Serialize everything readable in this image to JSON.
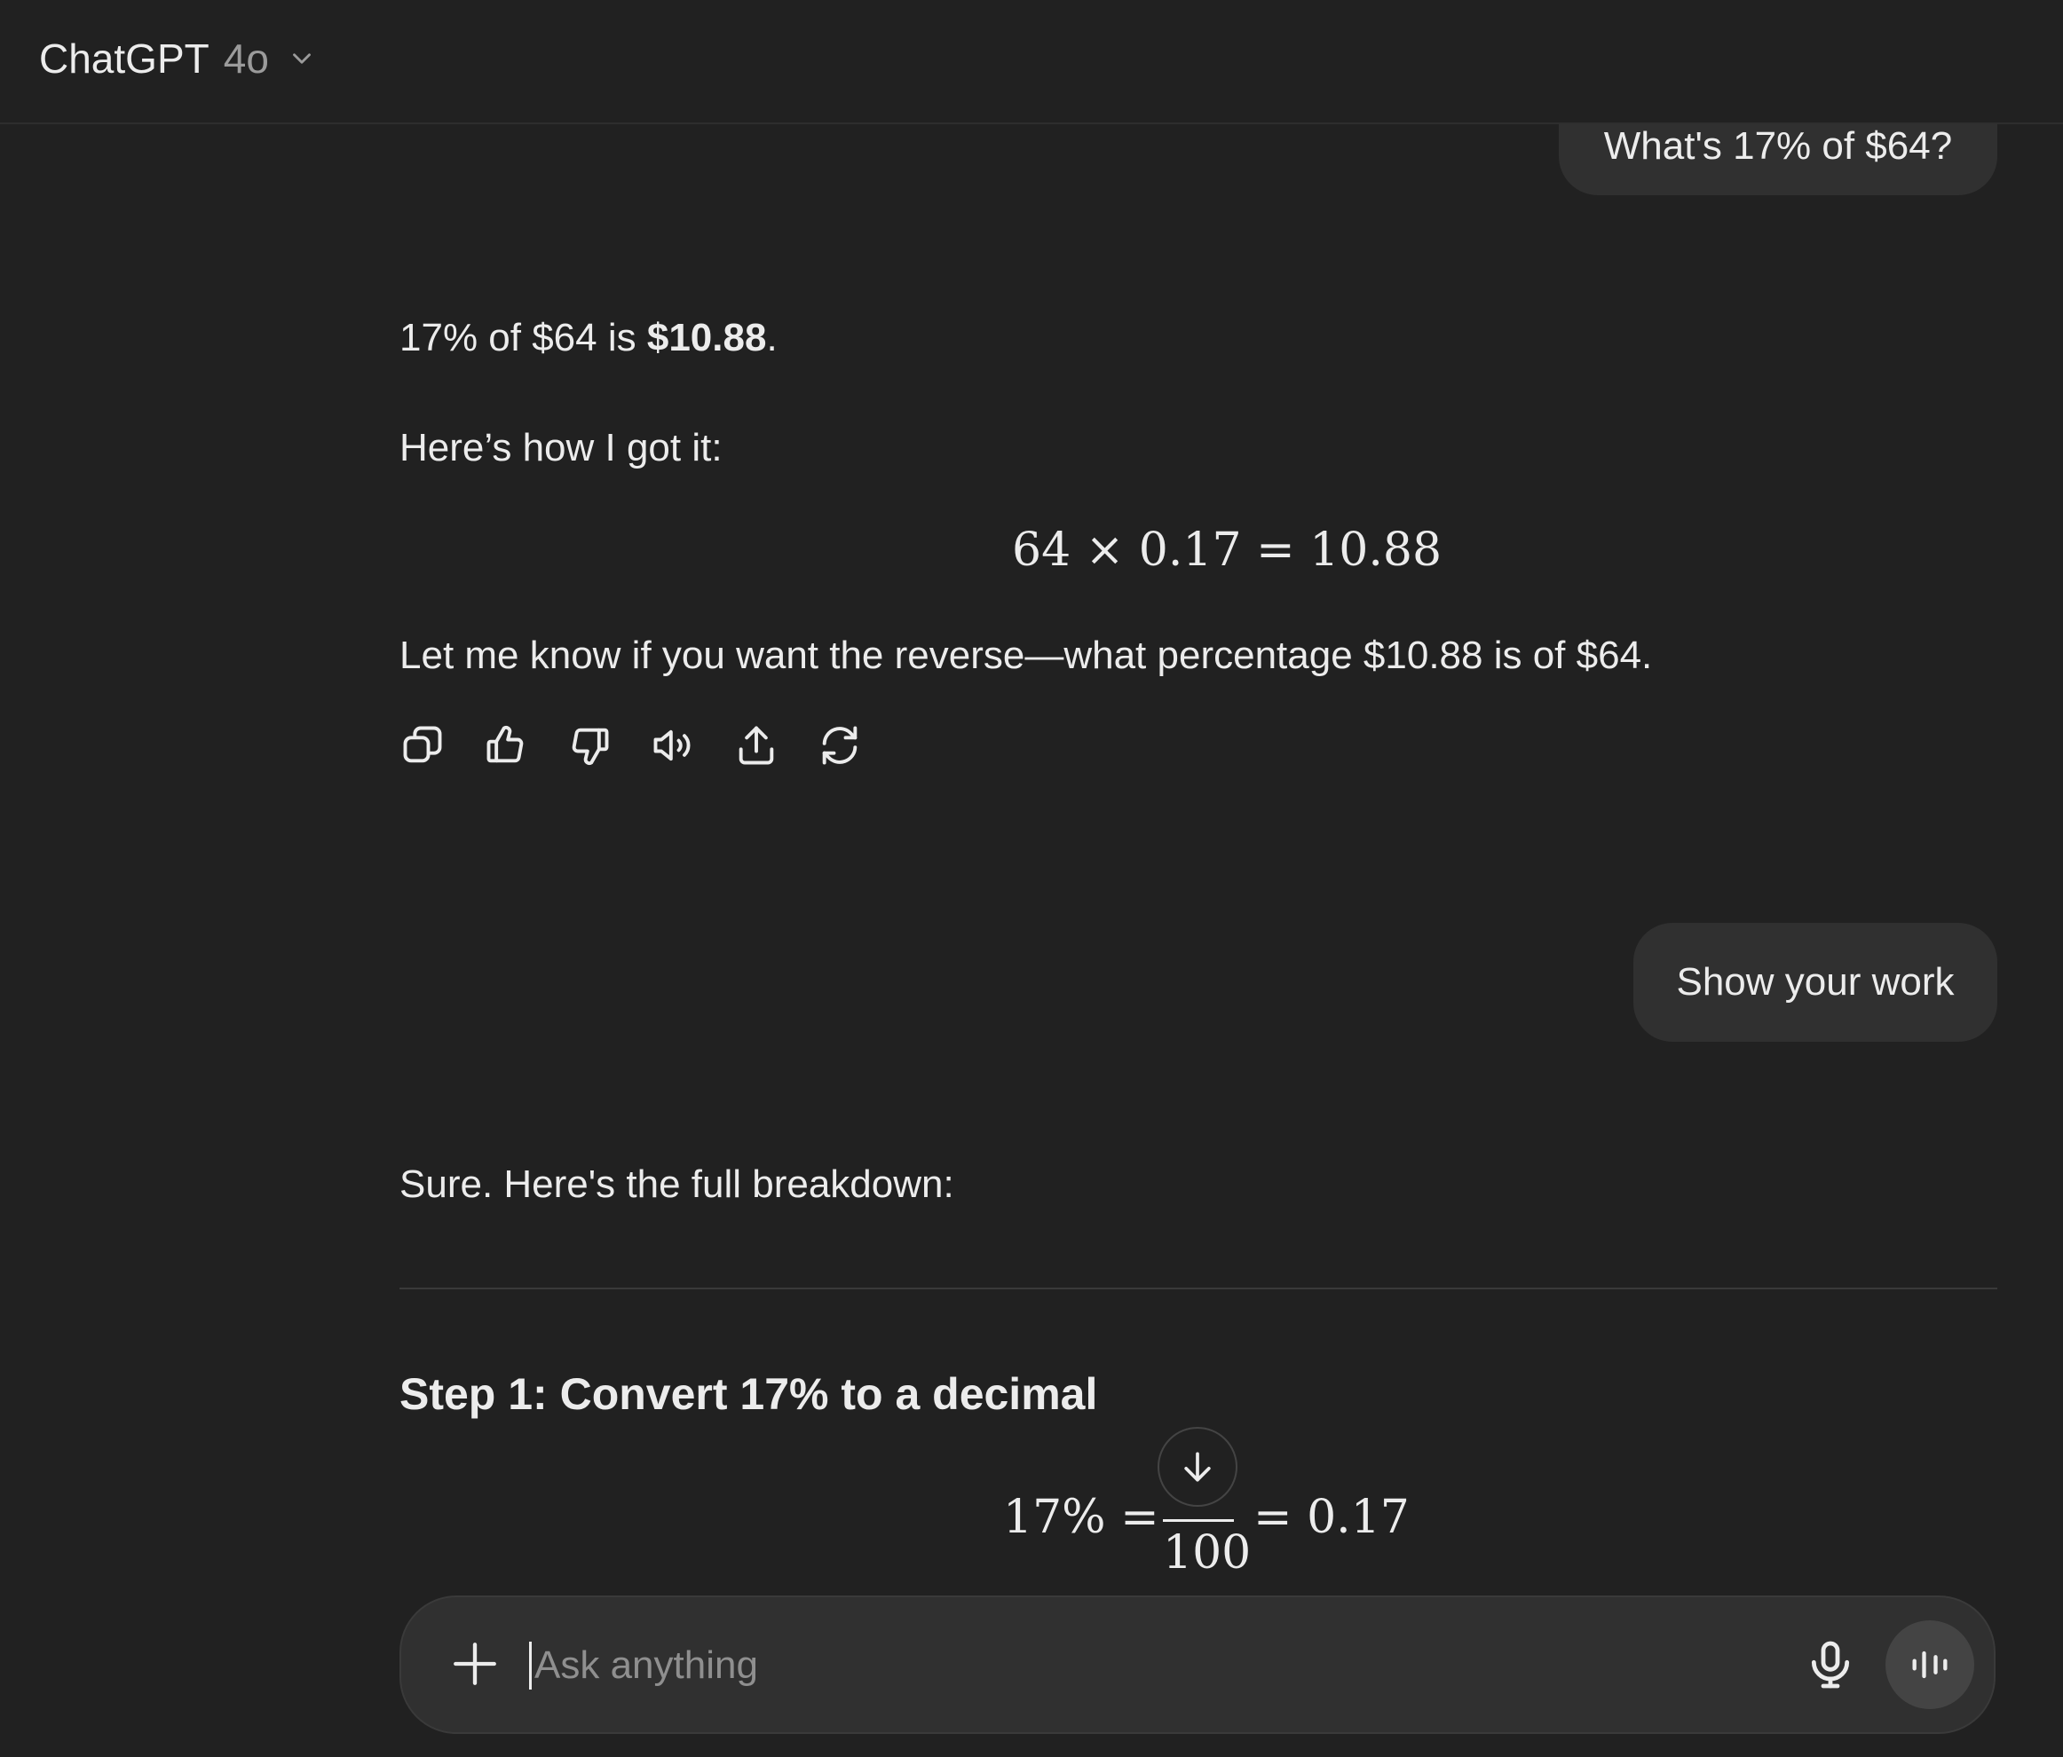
{
  "header": {
    "model_name": "ChatGPT",
    "model_version": "4o"
  },
  "conversation": {
    "user_message_1": "What's 17% of $64?",
    "assistant_1": {
      "answer_prefix": "17% of $64 is ",
      "answer_bold": "$10.88",
      "answer_suffix": ".",
      "how_intro": "Here’s how I got it:",
      "equation": "64 × 0.17 = 10.88",
      "followup": "Let me know if you want the reverse—what percentage $10.88 is of $64."
    },
    "actions": [
      "copy-icon",
      "thumbs-up-icon",
      "thumbs-down-icon",
      "read-aloud-icon",
      "share-icon",
      "regenerate-icon"
    ],
    "user_message_2": "Show your work",
    "assistant_2": {
      "intro": "Sure. Here's the full breakdown:",
      "step1_heading": "Step 1: Convert 17% to a decimal",
      "step1_lhs": "17% =",
      "step1_denominator": "100",
      "step1_rhs": "= 0.17"
    }
  },
  "composer": {
    "placeholder": "Ask anything"
  },
  "colors": {
    "background": "#212121",
    "bubble": "#303030",
    "text": "#ececec",
    "muted": "#9b9b9b"
  }
}
